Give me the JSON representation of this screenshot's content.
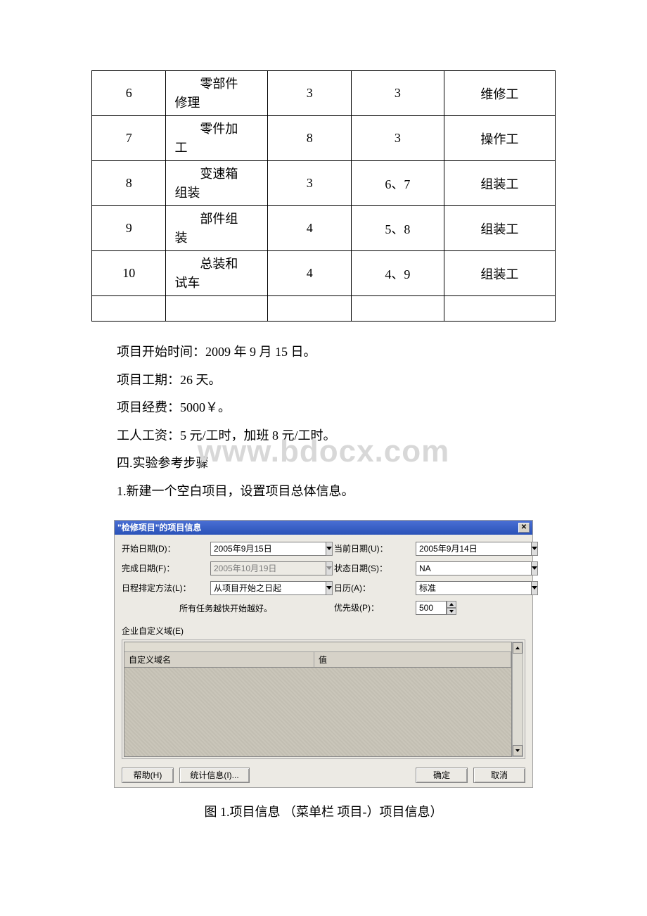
{
  "table": {
    "rows": [
      {
        "num": "6",
        "task_line1": "　　零部件",
        "task_line2": "修理",
        "duration": "3",
        "pred": "3",
        "resource": "维修工"
      },
      {
        "num": "7",
        "task_line1": "　　零件加",
        "task_line2": "工",
        "duration": "8",
        "pred": "3",
        "resource": "操作工"
      },
      {
        "num": "8",
        "task_line1": "　　变速箱",
        "task_line2": "组装",
        "duration": "3",
        "pred": "6、7",
        "resource": "组装工"
      },
      {
        "num": "9",
        "task_line1": "　　部件组",
        "task_line2": "装",
        "duration": "4",
        "pred": "5、8",
        "resource": "组装工"
      },
      {
        "num": "10",
        "task_line1": "　　总装和",
        "task_line2": "试车",
        "duration": "4",
        "pred": "4、9",
        "resource": "组装工"
      }
    ]
  },
  "paragraphs": {
    "p1": "项目开始时间：2009 年 9 月 15 日。",
    "p2": "项目工期：26 天。",
    "p3": "项目经费：5000￥。",
    "p4": "工人工资：5 元/工时，加班 8 元/工时。",
    "p5": "四.实验参考步骤",
    "p6": "1.新建一个空白项目，设置项目总体信息。"
  },
  "watermark": "www.bdocx.com",
  "dialog": {
    "title": "\"检修项目\"的项目信息",
    "labels": {
      "start_date": "开始日期(D)：",
      "finish_date": "完成日期(F)：",
      "schedule": "日程排定方法(L)：",
      "current_date": "当前日期(U)：",
      "status_date": "状态日期(S)：",
      "calendar": "日历(A)：",
      "priority": "优先级(P)：",
      "hint": "所有任务越快开始越好。",
      "custom": "企业自定义域(E)",
      "grid_col1": "自定义域名",
      "grid_col2": "值"
    },
    "values": {
      "start_date": "2005年9月15日",
      "finish_date": "2005年10月19日",
      "schedule": "从项目开始之日起",
      "current_date": "2005年9月14日",
      "status_date": "NA",
      "calendar": "标准",
      "priority": "500"
    },
    "buttons": {
      "help": "帮助(H)",
      "stats": "统计信息(I)...",
      "ok": "确定",
      "cancel": "取消"
    }
  },
  "caption": "图 1.项目信息 （菜单栏 项目-）项目信息）"
}
